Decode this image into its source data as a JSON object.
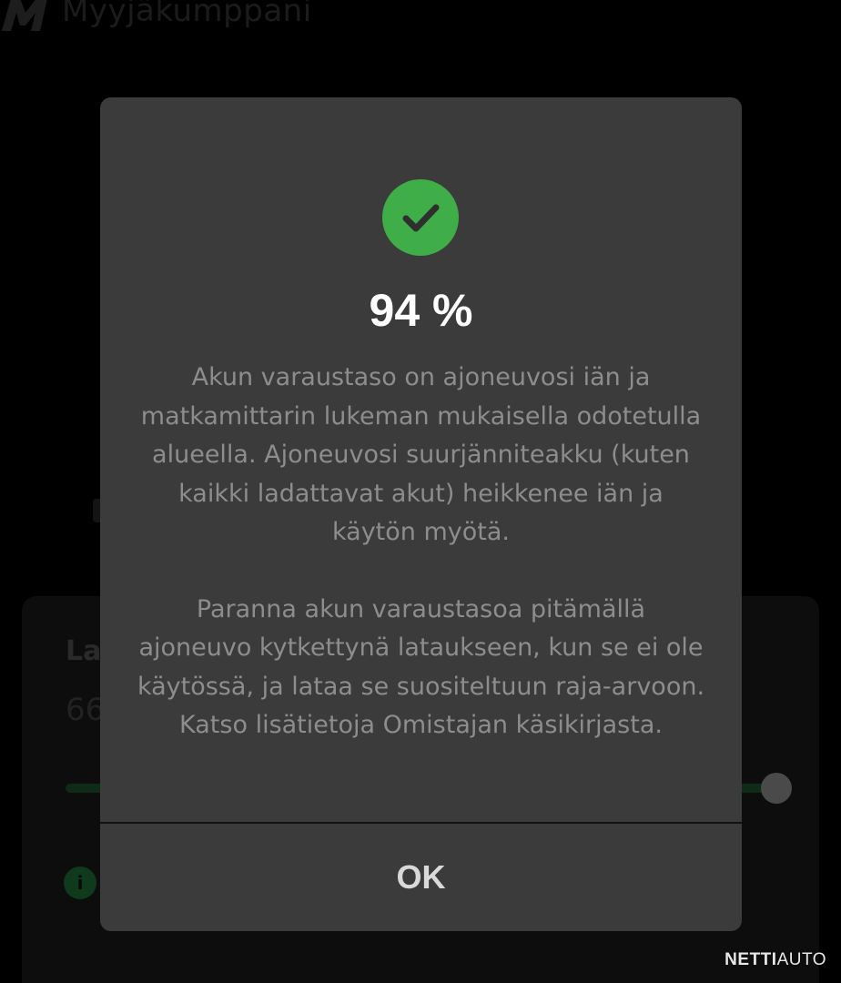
{
  "app": {
    "brand_name": "Myyjäkumppani"
  },
  "background": {
    "card_title": "La",
    "card_value": "66",
    "info_icon_glyph": "i",
    "slider_track_color": "#0f2b17"
  },
  "modal": {
    "icon": "check-circle-icon",
    "icon_color": "#3fae48",
    "percent": "94 %",
    "paragraph_1": "Akun varaustaso on ajoneuvosi iän ja matkamittarin lukeman mukaisella odotetulla alueella. Ajoneuvosi suurjänniteakku (kuten kaikki ladattavat akut) heikkenee iän ja käytön myötä.",
    "paragraph_2": "Paranna akun varaustasoa pitämällä ajoneuvo kytkettynä lataukseen, kun se ei ole käytössä, ja lataa se suositeltuun raja-arvoon. Katso lisätietoja Omistajan käsikirjasta.",
    "ok_label": "OK",
    "background_color": "#3b3b3b"
  },
  "watermark": {
    "part_1": "NETTI",
    "part_2": "AUTO"
  }
}
